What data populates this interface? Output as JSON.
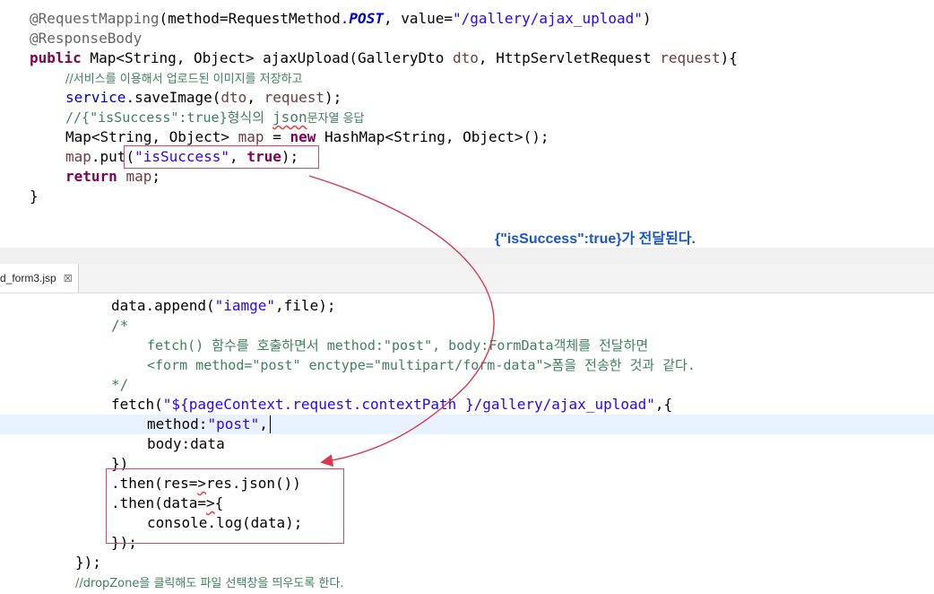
{
  "top_code": {
    "l1_ann": "@RequestMapping",
    "l1_rest_a": "(method=RequestMethod.",
    "l1_post": "POST",
    "l1_rest_b": ", value=",
    "l1_str": "\"/gallery/ajax_upload\"",
    "l1_end": ")",
    "l2_ann": "@ResponseBody",
    "l3_kw": "public",
    "l3_a": " Map<String, Object> ajaxUpload(GalleryDto ",
    "l3_p1": "dto",
    "l3_b": ", HttpServletRequest ",
    "l3_p2": "request",
    "l3_c": "){",
    "l4_cm": "//서비스를 이용해서 업로드된 이미지를 저장하고",
    "l5_fld": "service",
    "l5_a": ".saveImage(",
    "l5_p1": "dto",
    "l5_b": ", ",
    "l5_p2": "request",
    "l5_c": ");",
    "l6_cm_a": "//{\"isSuccess\":true}형식의 ",
    "l6_cm_json": "json",
    "l6_cm_b": "문자열 응답",
    "l7_a": "Map<String, Object> ",
    "l7_var": "map",
    "l7_b": " = ",
    "l7_kw": "new",
    "l7_c": " HashMap<String, Object>();",
    "l8_var": "map",
    "l8_a": ".put(",
    "l8_str": "\"isSuccess\"",
    "l8_b": ", ",
    "l8_kw": "true",
    "l8_c": ");",
    "l9_kw": "return",
    "l9_a": " ",
    "l9_var": "map",
    "l9_b": ";",
    "l10": "}"
  },
  "annotation": {
    "text": "{\"isSuccess\":true}가 전달된다."
  },
  "tab": {
    "label": "d_form3.jsp",
    "close": "☒"
  },
  "bottom_code": {
    "b1_a": "data.append(",
    "b1_str": "\"iamge\"",
    "b1_b": ",file);",
    "b2": "/*",
    "b3_a": "fetch() 함수를 호출하면서 method:\"post\", body:FormData객체를 전달하면",
    "b4_a": "<form method=\"post\" enctype=\"multipart/form-data\">폼을 전송한 것과 같다.",
    "b5": "*/",
    "b6_a": "fetch(",
    "b6_str": "\"${pageContext.request.contextPath }/gallery/ajax_upload\"",
    "b6_b": ",{",
    "b7_a": "method:",
    "b7_str": "\"post\"",
    "b7_b": ",",
    "b8": "body:data",
    "b9": "})",
    "b10_a": ".then(res=",
    "b10_arrow": ">",
    "b10_b": "res.json())",
    "b11_a": ".then(data=",
    "b11_arrow": ">",
    "b11_b": "{",
    "b12": "console.log(data);",
    "b13": "});",
    "b14": "});",
    "b15": "//dropZone을 클릭해도 파일 선택창을 띄우도록 한다."
  },
  "colors": {
    "annotation_box": "#e0475e",
    "arrow": "#d8374e",
    "annotation_text": "#1a56c9",
    "keyword": "#7f0055",
    "string": "#2a00ff",
    "comment": "#3f7f5f"
  }
}
